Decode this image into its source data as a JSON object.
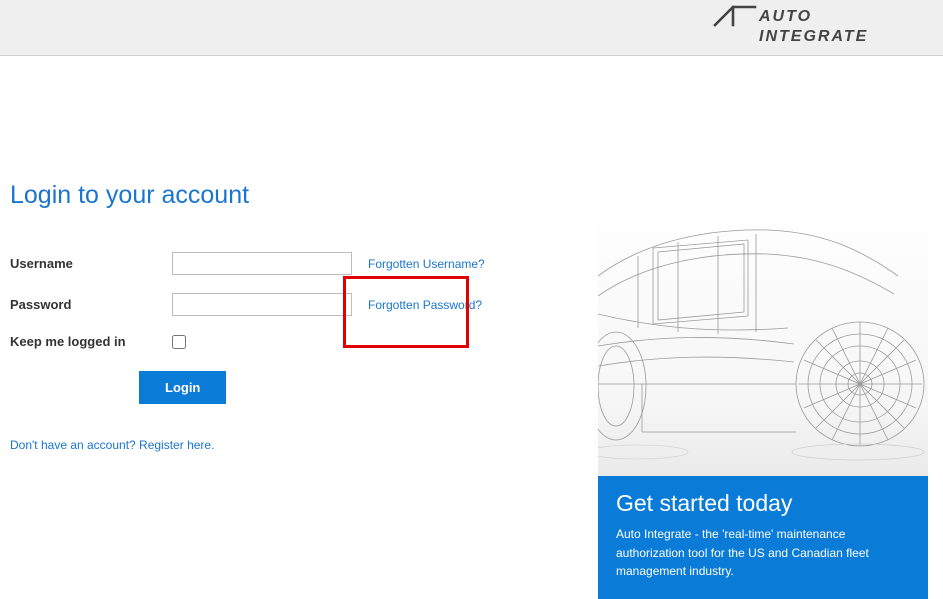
{
  "brand": {
    "name": "AUTO INTEGRATE"
  },
  "form": {
    "heading": "Login to your account",
    "username_label": "Username",
    "password_label": "Password",
    "keep_logged_label": "Keep me logged in",
    "login_button": "Login",
    "forgot_username": "Forgotten Username?",
    "forgot_password": "Forgotten Password?",
    "register_prompt": "Don't have an account? Register here.",
    "username_value": "",
    "password_value": ""
  },
  "cta": {
    "title": "Get started today",
    "body": "Auto Integrate - the 'real-time' maintenance authorization tool for the US and Canadian fleet management industry."
  }
}
